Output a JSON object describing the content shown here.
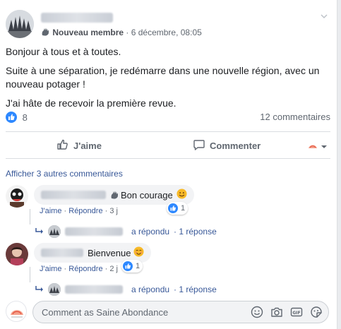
{
  "post": {
    "author_badge": "Nouveau membre",
    "timestamp": "· 6 décembre, 08:05",
    "paragraphs": [
      "Bonjour à tous et à toutes.",
      "Suite à une séparation, je redémarre dans une nouvelle région, avec un nouveau potager !",
      "J'ai hâte de recevoir la première revue."
    ],
    "like_count": "8",
    "comment_count": "12 commentaires"
  },
  "actions": {
    "like_label": "J'aime",
    "comment_label": "Commenter"
  },
  "comments_section": {
    "show_more": "Afficher 3 autres commentaires",
    "comments": [
      {
        "text": "Bon courage",
        "like_label": "J'aime",
        "reply_label": "Répondre",
        "time": "· 3 j",
        "reaction_count": "1",
        "reply_summary": "a répondu",
        "reply_count": "· 1 réponse"
      },
      {
        "text": "Bienvenue",
        "like_label": "J'aime",
        "reply_label": "Répondre",
        "time": "· 2 j",
        "reaction_count": "1",
        "reply_summary": "a répondu",
        "reply_count": "· 1 réponse"
      }
    ]
  },
  "composer": {
    "placeholder": "Comment as Saine Abondance"
  },
  "colors": {
    "link": "#385898",
    "like_blue": "#2d88ff",
    "muted": "#606770"
  }
}
